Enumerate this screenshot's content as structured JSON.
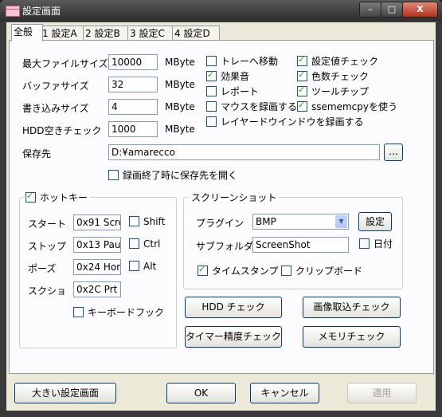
{
  "window": {
    "title": "設定画面",
    "buttons": {
      "minimize": "–",
      "maximize": "□",
      "close": "X"
    }
  },
  "tabs": [
    "全般",
    "1 設定A",
    "2 設定B",
    "3 設定C",
    "4 設定D"
  ],
  "general": {
    "max_file_size": {
      "label": "最大ファイルサイズ",
      "value": "10000",
      "unit": "MByte"
    },
    "buffer_size": {
      "label": "バッファサイズ",
      "value": "32",
      "unit": "MByte"
    },
    "write_size": {
      "label": "書き込みサイズ",
      "value": "4",
      "unit": "MByte"
    },
    "hdd_free": {
      "label": "HDD空きチェック",
      "value": "1000",
      "unit": "MByte"
    },
    "save_to": {
      "label": "保存先",
      "value": "D:¥amarecco",
      "browse": "..."
    },
    "open_on_finish": "録画終了時に保存先を開く"
  },
  "options_mid": [
    {
      "label": "トレーへ移動",
      "checked": false
    },
    {
      "label": "効果音",
      "checked": true
    },
    {
      "label": "レポート",
      "checked": false
    },
    {
      "label": "マウスを録画する",
      "checked": false
    },
    {
      "label": "レイヤードウインドウを録画する",
      "checked": false
    }
  ],
  "options_right": [
    {
      "label": "設定値チェック",
      "checked": true
    },
    {
      "label": "色数チェック",
      "checked": true
    },
    {
      "label": "ツールチップ",
      "checked": true
    },
    {
      "label": "ssememcpyを使う",
      "checked": true
    }
  ],
  "hotkey": {
    "title": "ホットキー",
    "enabled": true,
    "rows": [
      {
        "label": "スタート",
        "value": "0x91 Scro",
        "mod": "Shift"
      },
      {
        "label": "ストップ",
        "value": "0x13 Paus",
        "mod": "Ctrl"
      },
      {
        "label": "ポーズ",
        "value": "0x24 Hom",
        "mod": "Alt"
      },
      {
        "label": "スクショ",
        "value": "0x2C Prt"
      }
    ],
    "keyboard_hook": "キーボードフック"
  },
  "screenshot": {
    "title": "スクリーンショット",
    "plugin_label": "プラグイン",
    "plugin_value": "BMP",
    "settings_button": "設定",
    "subfolder_label": "サブフォルダ",
    "subfolder_value": "ScreenShot",
    "date_label": "日付",
    "timestamp": "タイムスタンプ",
    "timestamp_checked": true,
    "clipboard": "クリップボード"
  },
  "actions": {
    "hdd_check": "HDD チェック",
    "image_check": "画像取込チェック",
    "timer_check": "タイマー精度チェック",
    "memory_check": "メモリチェック"
  },
  "footer": {
    "large_settings": "大きい設定画面",
    "ok": "OK",
    "cancel": "キャンセル",
    "apply": "適用"
  }
}
